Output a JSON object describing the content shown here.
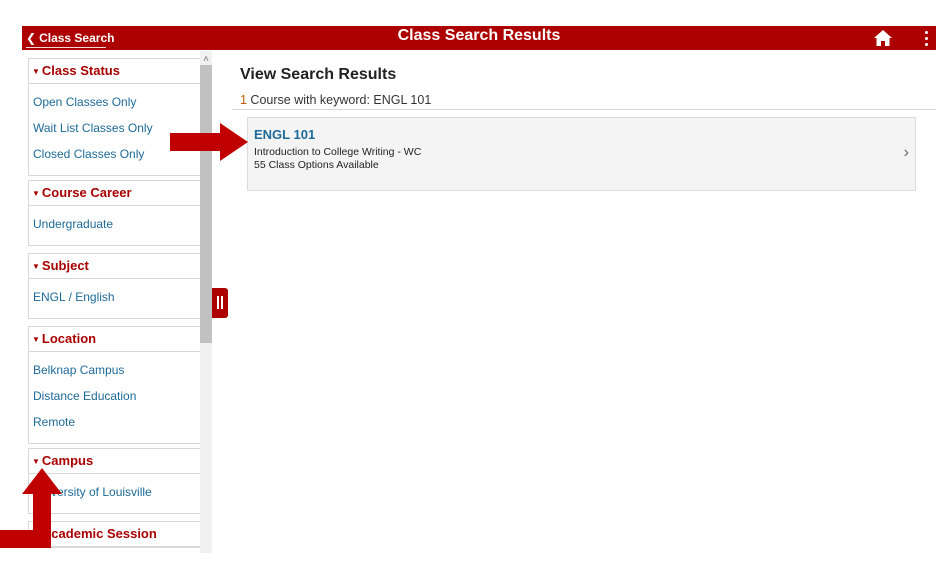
{
  "topbar": {
    "back_label": "Class Search",
    "title": "Class Search Results"
  },
  "sidebar": {
    "groups": [
      {
        "title": "Class Status",
        "options": [
          "Open Classes Only",
          "Wait List Classes Only",
          "Closed Classes Only"
        ]
      },
      {
        "title": "Course Career",
        "options": [
          "Undergraduate"
        ]
      },
      {
        "title": "Subject",
        "options": [
          "ENGL / English"
        ]
      },
      {
        "title": "Location",
        "options": [
          "Belknap Campus",
          "Distance Education",
          "Remote"
        ]
      },
      {
        "title": "Campus",
        "options": [
          "University of Louisville"
        ]
      },
      {
        "title": "Academic Session",
        "options": []
      }
    ]
  },
  "main": {
    "heading": "View Search Results",
    "result_count": "1",
    "result_text": " Course with keyword: ENGL 101",
    "course": {
      "code": "ENGL 101",
      "title": "Introduction to College Writing - WC",
      "options": "55 Class Options Available"
    }
  },
  "colors": {
    "brand_red": "#ad0000",
    "link_blue": "#1d6a98",
    "annotation_arrow": "#c00000"
  },
  "icons": [
    "chevron-left-icon",
    "home-icon",
    "more-vertical-icon",
    "triangle-down-icon",
    "chevron-right-icon",
    "pause-icon"
  ]
}
